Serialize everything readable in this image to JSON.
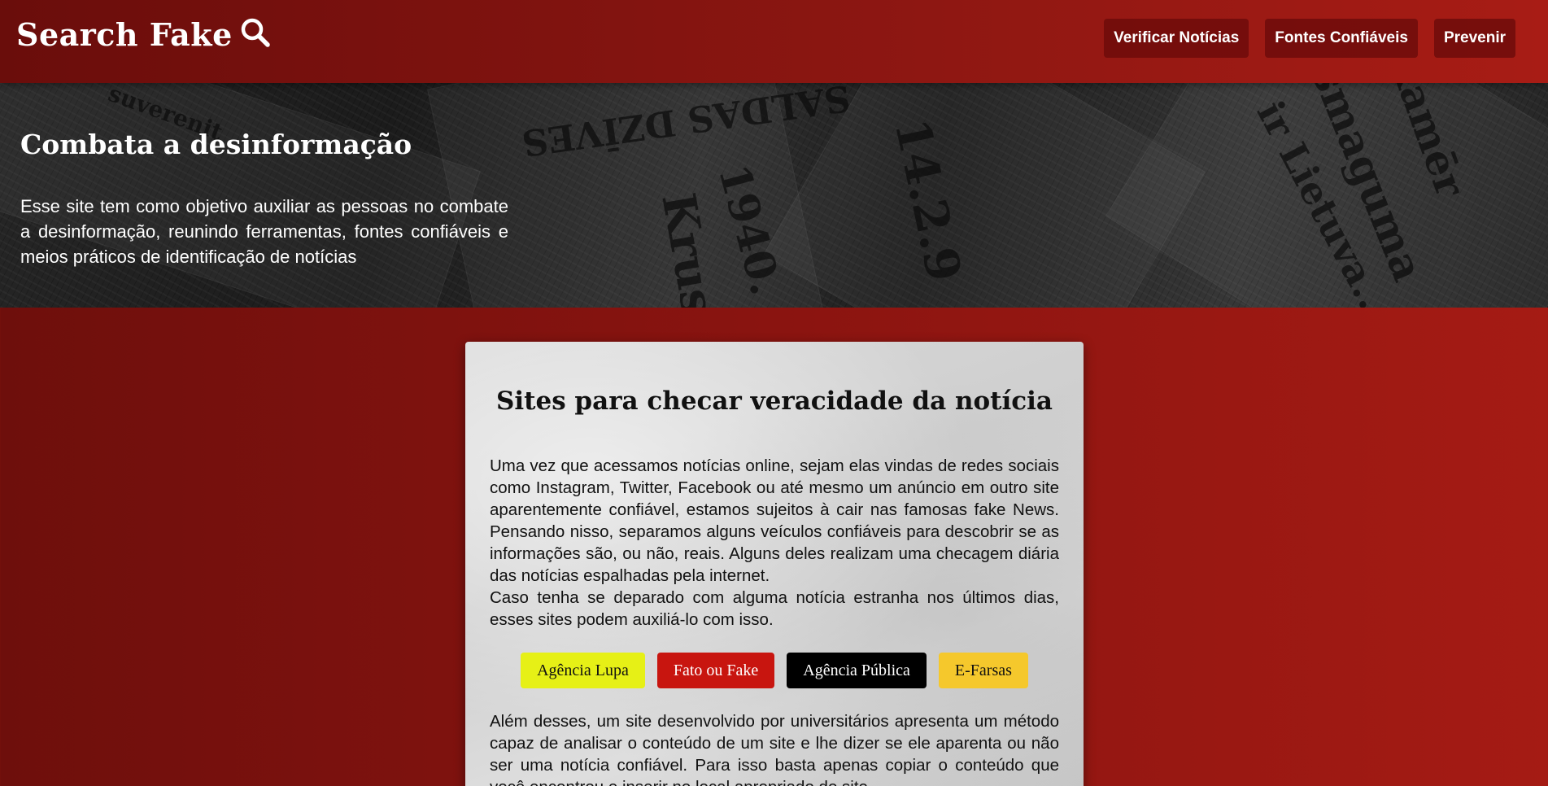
{
  "header": {
    "logo_text": "Search Fake",
    "logo_icon": "search-icon",
    "nav": [
      {
        "label": "Verificar Notícias"
      },
      {
        "label": "Fontes Confiáveis"
      },
      {
        "label": "Prevenir"
      }
    ]
  },
  "hero": {
    "title": "Combata a desinformação",
    "text": "Esse site tem como objetivo auxiliar as pessoas no combate a desinformação, reunindo ferramentas, fontes confiáveis e meios práticos de identificação de notícias",
    "background_headlines": [
      "SALDAS DZĪVES",
      "14.2.9",
      "1940.",
      "Krust",
      "smaguma",
      "ir Lietuva...",
      "Kamēr",
      "suverenit"
    ]
  },
  "card": {
    "title": "Sites para checar veracidade da notícia",
    "paragraph1": "Uma vez que acessamos notícias online, sejam elas vindas de redes sociais como Instagram, Twitter, Facebook ou até mesmo um anúncio em outro site aparentemente confiável, estamos sujeitos à cair nas famosas fake News. Pensando nisso, separamos alguns veículos confiáveis para descobrir se as informações são, ou não, reais. Alguns deles realizam uma checagem diária das notícias espalhadas pela internet.",
    "paragraph2": "Caso tenha se deparado com alguma notícia estranha nos últimos dias, esses sites podem auxiliá-lo com isso.",
    "sites": [
      {
        "label": "Agência Lupa",
        "bg": "#e6f016",
        "fg": "#111111"
      },
      {
        "label": "Fato ou Fake",
        "bg": "#c8150f",
        "fg": "#ffffff"
      },
      {
        "label": "Agência Pública",
        "bg": "#000000",
        "fg": "#ffffff"
      },
      {
        "label": "E-Farsas",
        "bg": "#f5c82c",
        "fg": "#111111"
      }
    ],
    "paragraph3": "Além desses, um site desenvolvido por universitários apresenta um método capaz de analisar o conteúdo de um site e lhe dizer se ele aparenta ou não ser uma notícia confiável. Para isso basta apenas copiar o conteúdo que você encontrou e inserir no local apropriado do site."
  },
  "colors": {
    "brand_red": "#8e1712",
    "dark_red": "#6a0d0b",
    "white": "#ffffff"
  }
}
